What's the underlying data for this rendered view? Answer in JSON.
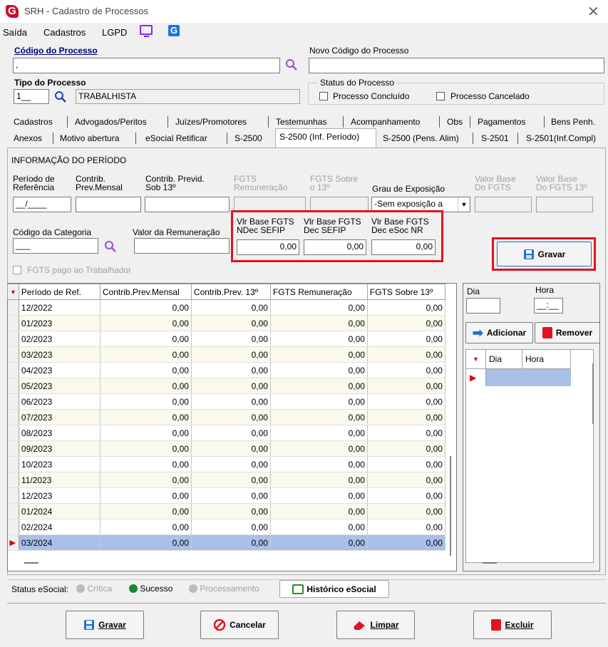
{
  "window": {
    "title": "SRH - Cadastro de Processos",
    "logo_letter": "G",
    "close": "✕"
  },
  "menu": [
    "Saída",
    "Cadastros",
    "LGPD"
  ],
  "icons": {
    "gemini": "G"
  },
  "codigo": {
    "label": "Código do Processo",
    "value": ","
  },
  "novo_codigo": {
    "label": "Novo Código do Processo",
    "value": ""
  },
  "tipo": {
    "label": "Tipo do Processo",
    "code": "1__",
    "desc": "TRABALHISTA"
  },
  "status": {
    "legend": "Status do Processo",
    "concluido": "Processo Concluído",
    "cancelado": "Processo Cancelado"
  },
  "tabs_row1": [
    "Cadastros",
    "Advogados/Peritos",
    "Juízes/Promotores",
    "Testemunhas",
    "Acompanhamento",
    "Obs",
    "Pagamentos",
    "Bens Penh."
  ],
  "tabs_row2": [
    "Anexos",
    "Motivo abertura",
    "eSocial Retificar",
    "S-2500",
    "S-2500 (Inf. Período)",
    "S-2500 (Pens. Alim)",
    "S-2501",
    "S-2501(Inf.Compl)"
  ],
  "section": "INFORMAÇÃO DO PERÍODO",
  "fields": {
    "periodo": {
      "label1": "Período de",
      "label2": "Referência",
      "value": "__/____"
    },
    "contrib_mensal": {
      "label1": "Contrib.",
      "label2": "Prev.Mensal",
      "value": ""
    },
    "contrib_13": {
      "label1": "Contrib. Previd.",
      "label2": "Sob 13º",
      "value": ""
    },
    "fgts_rem": {
      "label1": "FGTS",
      "label2": "Remuneração",
      "value": ""
    },
    "fgts_13": {
      "label1": "FGTS Sobre",
      "label2": "o 13º",
      "value": ""
    },
    "grau": {
      "label": "Grau de Exposição",
      "value": "-Sem exposição a"
    },
    "vb_fgts": {
      "label1": "Valor Base",
      "label2": "Do FGTS",
      "value": ""
    },
    "vb_fgts13": {
      "label1": "Valor Base",
      "label2": "Do FGTS 13º",
      "value": ""
    },
    "categoria": {
      "label": "Código da Categoria",
      "value": "___"
    },
    "valor_rem": {
      "label": "Valor da Remuneração",
      "value": ""
    },
    "vlr_ndec": {
      "label1": "Vlr Base FGTS",
      "label2": "NDec SEFIP",
      "value": "0,00"
    },
    "vlr_dec": {
      "label1": "Vlr Base FGTS",
      "label2": "Dec SEFIP",
      "value": "0,00"
    },
    "vlr_esoc": {
      "label1": "Vlr Base FGTS",
      "label2": "Dec eSoc NR",
      "value": "0,00"
    },
    "fgts_pago": "FGTS pago ao Trabalhador"
  },
  "gravar_top": "Gravar",
  "grid": {
    "headers": [
      "Período de Ref.",
      "Contrib.Prev.Mensal",
      "Contrib.Prev. 13º",
      "FGTS Remuneração",
      "FGTS Sobre 13º"
    ],
    "rows": [
      [
        "12/2022",
        "0,00",
        "0,00",
        "0,00",
        "0,00"
      ],
      [
        "01/2023",
        "0,00",
        "0,00",
        "0,00",
        "0,00"
      ],
      [
        "02/2023",
        "0,00",
        "0,00",
        "0,00",
        "0,00"
      ],
      [
        "03/2023",
        "0,00",
        "0,00",
        "0,00",
        "0,00"
      ],
      [
        "04/2023",
        "0,00",
        "0,00",
        "0,00",
        "0,00"
      ],
      [
        "05/2023",
        "0,00",
        "0,00",
        "0,00",
        "0,00"
      ],
      [
        "06/2023",
        "0,00",
        "0,00",
        "0,00",
        "0,00"
      ],
      [
        "07/2023",
        "0,00",
        "0,00",
        "0,00",
        "0,00"
      ],
      [
        "08/2023",
        "0,00",
        "0,00",
        "0,00",
        "0,00"
      ],
      [
        "09/2023",
        "0,00",
        "0,00",
        "0,00",
        "0,00"
      ],
      [
        "10/2023",
        "0,00",
        "0,00",
        "0,00",
        "0,00"
      ],
      [
        "11/2023",
        "0,00",
        "0,00",
        "0,00",
        "0,00"
      ],
      [
        "12/2023",
        "0,00",
        "0,00",
        "0,00",
        "0,00"
      ],
      [
        "01/2024",
        "0,00",
        "0,00",
        "0,00",
        "0,00"
      ],
      [
        "02/2024",
        "0,00",
        "0,00",
        "0,00",
        "0,00"
      ],
      [
        "03/2024",
        "0,00",
        "0,00",
        "0,00",
        "0,00"
      ]
    ]
  },
  "side": {
    "dia": "Dia",
    "hora": "Hora",
    "hora_value": "__:__",
    "adicionar": "Adicionar",
    "remover": "Remover",
    "col_dia": "Dia",
    "col_hora": "Hora"
  },
  "status_bar": {
    "label": "Status eSocial:",
    "critica": "Crítica",
    "sucesso": "Sucesso",
    "processamento": "Processamento",
    "historico": "Histórico eSocial"
  },
  "buttons": {
    "gravar": "Gravar",
    "cancelar": "Cancelar",
    "limpar": "Limpar",
    "excluir": "Excluir"
  }
}
